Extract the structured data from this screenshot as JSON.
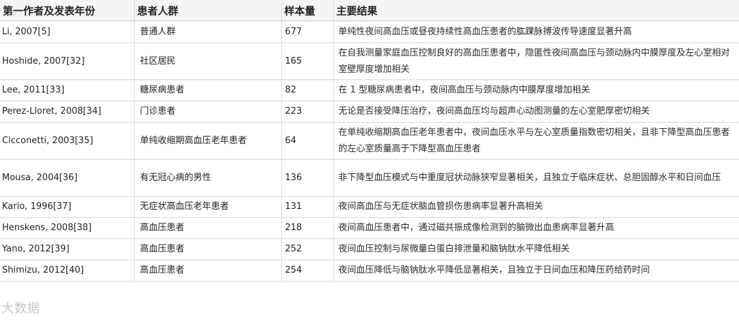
{
  "table": {
    "headers": [
      "第一作者及发表年份",
      "患者人群",
      "样本量",
      "主要结果"
    ],
    "rows": [
      {
        "author": "Li, 2007[5]",
        "group": "普通人群",
        "n": "677",
        "result": "单纯性夜间高血压或昼夜持续性高血压患者的肱踝脉搏波传导速度显著升高"
      },
      {
        "author": "Hoshide, 2007[32]",
        "group": "社区居民",
        "n": "165",
        "result": "在自我测量家庭血压控制良好的高血压患者中，隐匿性夜间高血压与颈动脉内中膜厚度及左心室相对室壁厚度增加相关"
      },
      {
        "author": "Lee, 2011[33]",
        "group": "糖尿病患者",
        "n": "82",
        "result": "在 1 型糖尿病患者中，夜间高血压与颈动脉内中膜厚度增加相关"
      },
      {
        "author": "Perez-Lloret, 2008[34]",
        "group": "门诊患者",
        "n": "223",
        "result": "无论是否接受降压治疗，夜间高血压均与超声心动图测量的左心室肥厚密切相关"
      },
      {
        "author": "Cicconetti, 2003[35]",
        "group": "单纯收缩期高血压老年患者",
        "n": "64",
        "result": "在单纯收缩期高血压老年患者中，夜间血压水平与左心室质量指数密切相关，且非下降型高血压患者的左心室质量高于下降型高血压患者"
      },
      {
        "author": "Mousa, 2004[36]",
        "group": "有无冠心病的男性",
        "n": "136",
        "result": "非下降型血压模式与中重度冠状动脉狭窄显著相关，且独立于临床症状、总胆固醇水平和日间血压"
      },
      {
        "author": "Kario, 1996[37]",
        "group": "无症状高血压老年患者",
        "n": "131",
        "result": "夜间高血压与无症状脑血管损伤患病率显著升高相关"
      },
      {
        "author": "Henskens, 2008[38]",
        "group": "高血压患者",
        "n": "218",
        "result": "夜间高血压患者中，通过磁共振成像检测到的脑微出血患病率显著升高"
      },
      {
        "author": "Yano, 2012[39]",
        "group": "高血压患者",
        "n": "252",
        "result": "夜间血压控制与尿微量白蛋白排泄量和脑钠肽水平降低相关"
      },
      {
        "author": "Shimizu, 2012[40]",
        "group": "高血压患者",
        "n": "254",
        "result": "夜间血压降低与脑钠肽水平降低显著相关，且独立于日间血压和降压药给药时间"
      }
    ]
  },
  "watermark": "大数据"
}
